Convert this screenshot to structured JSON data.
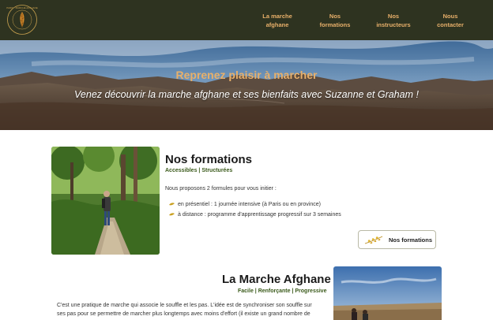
{
  "nav": {
    "logo_text": "PARIS · MARCHE AFGHANE",
    "items": [
      {
        "line1": "La marche",
        "line2": "afghane"
      },
      {
        "line1": "Nos",
        "line2": "formations"
      },
      {
        "line1": "Nos",
        "line2": "instructeurs"
      },
      {
        "line1": "Nous",
        "line2": "contacter"
      }
    ]
  },
  "hero": {
    "title": "Reprenez plaisir à marcher",
    "subtitle": "Venez découvrir la marche afghane et ses bienfaits avec Suzanne et Graham !"
  },
  "formations": {
    "title": "Nos formations",
    "tagline": "Accessibles | Structurées",
    "intro": "Nous proposons 2 formules pour vous initier :",
    "bullets": [
      "en présentiel : 1 journée intensive (à Paris ou en province)",
      "à distance : programme d'apprentissage progressif sur 3 semaines"
    ],
    "button_label": "Nos formations"
  },
  "marche": {
    "title": "La Marche Afghane",
    "tagline": "Facile | Renforçante | Progressive",
    "line1": "C'est une pratique de marche qui associe le souffle et les pas. L'idée est de synchroniser son souffle sur",
    "line2": "ses pas pour se permettre de marcher plus longtemps avec moins d'effort (il existe un grand nombre de"
  },
  "colors": {
    "nav_bg": "#2e3320",
    "accent": "#e8b06a",
    "tag_green": "#3a5a1a"
  }
}
